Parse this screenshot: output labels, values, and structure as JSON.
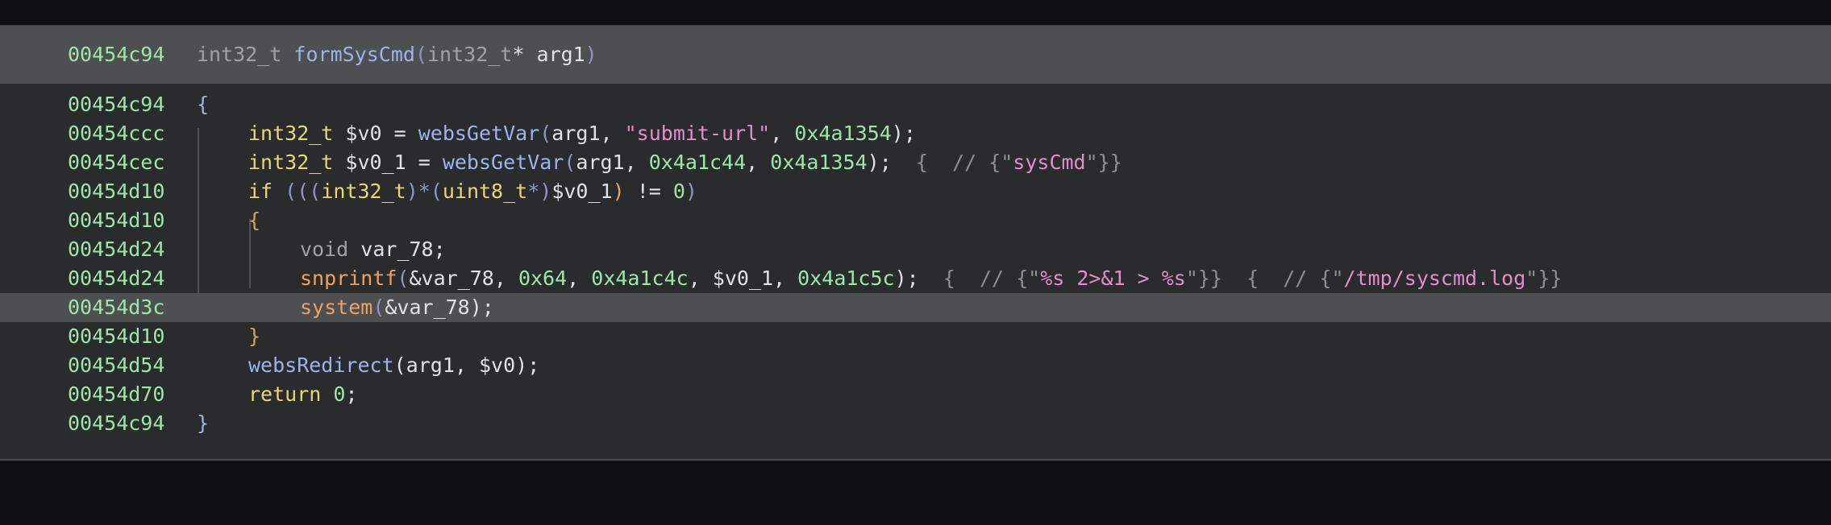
{
  "header": {
    "address": "00454c94",
    "return_type": "int32_t",
    "function_name": "formSysCmd",
    "param_type": "int32_t",
    "param_rest": "* arg1"
  },
  "lines": [
    {
      "addr": "00454c94",
      "tokens": [
        "{"
      ]
    },
    {
      "addr": "00454ccc",
      "tokens": [
        "int32_t",
        " $v0 = ",
        "websGetVar",
        "(",
        "arg1, ",
        "\"submit-url\"",
        ", ",
        "0x4a1354",
        ");"
      ]
    },
    {
      "addr": "00454cec",
      "tokens": [
        "int32_t",
        " $v0_1 = ",
        "websGetVar",
        "(",
        "arg1, ",
        "0x4a1c44",
        ", ",
        "0x4a1354",
        ");",
        "  {  // {\"",
        "sysCmd",
        "\"}}"
      ]
    },
    {
      "addr": "00454d10",
      "tokens": [
        "if",
        " ",
        "(((",
        "int32_t",
        ")*(",
        "uint8_t",
        "*)",
        "$v0_1",
        ")",
        " != ",
        "0",
        ")"
      ]
    },
    {
      "addr": "00454d10",
      "tokens": [
        "{"
      ]
    },
    {
      "addr": "00454d24",
      "tokens": [
        "void",
        " var_78;"
      ]
    },
    {
      "addr": "00454d24",
      "tokens": [
        "snprintf",
        "(",
        "&var_78, ",
        "0x64",
        ", ",
        "0x4a1c4c",
        ", $v0_1, ",
        "0x4a1c5c",
        ");",
        "  {  // {\"",
        "%s 2>&1 > %s",
        "\"}}",
        "  {  // {\"",
        "/tmp/syscmd.log",
        "\"}}"
      ]
    },
    {
      "addr": "00454d3c",
      "tokens": [
        "system",
        "(",
        "&var_78",
        ");"
      ]
    },
    {
      "addr": "00454d10",
      "tokens": [
        "}"
      ]
    },
    {
      "addr": "00454d54",
      "tokens": [
        "websRedirect",
        "(arg1, $v0);"
      ]
    },
    {
      "addr": "00454d70",
      "tokens": [
        "return",
        " ",
        "0",
        ";"
      ]
    },
    {
      "addr": "00454c94",
      "tokens": [
        "}"
      ]
    }
  ],
  "highlighted_line_index": 7,
  "colors": {
    "background": "#2a2b2d",
    "header_background": "#4d4f51",
    "address": "#9ee6a8",
    "type": "#e9d774",
    "function": "#9cb4ee",
    "call": "#f1a060",
    "number": "#9ee6a8",
    "string": "#e58ccc",
    "comment": "#8d8f91"
  }
}
